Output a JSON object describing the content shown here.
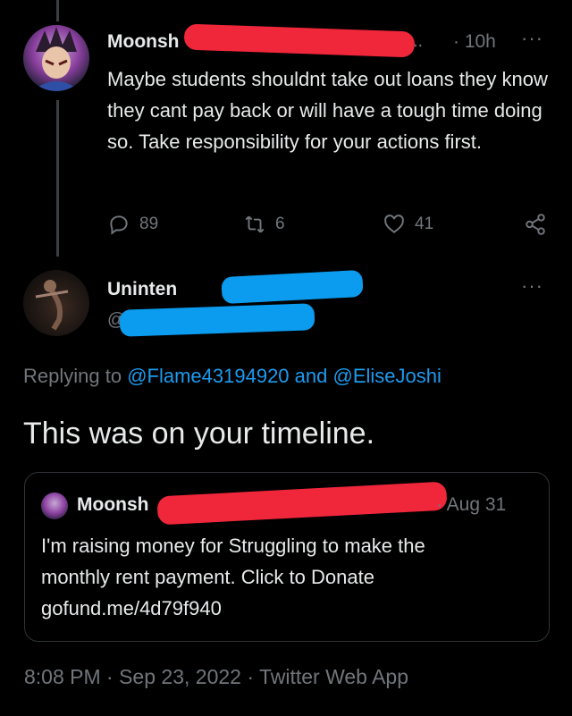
{
  "first_tweet": {
    "author_name_visible": "Moonsh",
    "separator_dots": "..",
    "time": "· 10h",
    "text": "Maybe students shouldnt take out loans they know they cant pay back or will have a tough time doing so. Take responsibility for your actions first.",
    "replies": "89",
    "retweets": "6",
    "likes": "41"
  },
  "reply_tweet": {
    "author_name_visible": "Uninten",
    "handle_visible": "@",
    "replying_prefix": "Replying to",
    "replying_user1": "@Flame43194920",
    "replying_and": "and",
    "replying_user2": "@EliseJoshi",
    "text": "This was on your timeline.",
    "timestamp": "8:08 PM · Sep 23, 2022 · Twitter Web App"
  },
  "quoted_tweet": {
    "author_name_visible": "Moonsh",
    "date": "· Aug 31",
    "text_line1": "I'm raising money for Struggling to make the",
    "text_line2": "monthly rent payment. Click to Donate",
    "link": "gofund.me/4d79f940"
  },
  "icons": {
    "more": "more-icon",
    "reply": "reply-icon",
    "retweet": "retweet-icon",
    "like": "heart-icon",
    "share": "share-icon"
  },
  "colors": {
    "background": "#000000",
    "text": "#e7e9ea",
    "muted": "#71767b",
    "link": "#1d9bf0",
    "redaction_red": "#f0263b",
    "redaction_blue": "#0b9cf0"
  }
}
